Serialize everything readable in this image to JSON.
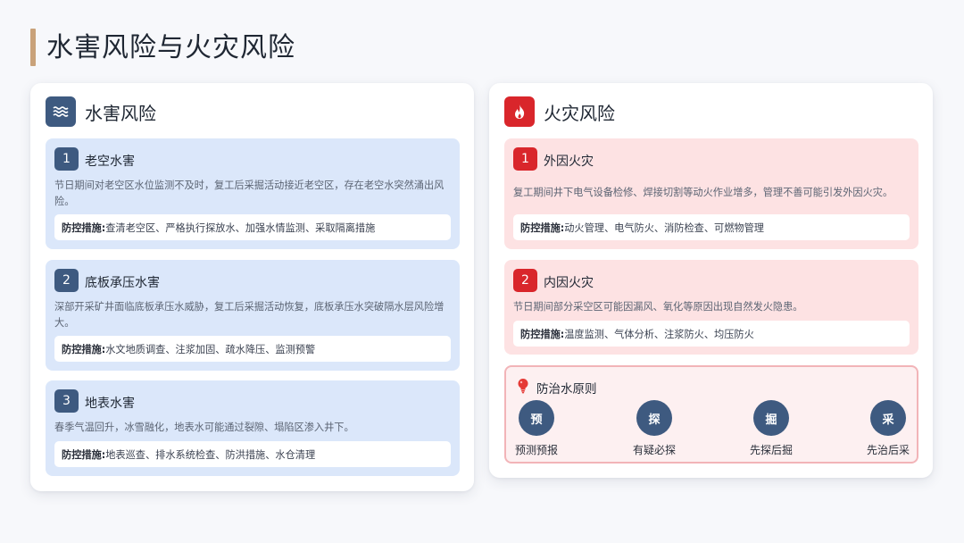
{
  "page": {
    "title": "水害风险与火灾风险"
  },
  "water": {
    "title": "水害风险",
    "icon": "water-waves-icon",
    "accent": "#3e5a80",
    "card_bg": "#dbe7fa",
    "items": [
      {
        "num": "1",
        "title": "老空水害",
        "desc": "节日期间对老空区水位监测不及时，复工后采掘活动接近老空区，存在老空水突然涌出风险。",
        "measure_label": "防控措施:",
        "measure": "查清老空区、严格执行探放水、加强水情监测、采取隔离措施"
      },
      {
        "num": "2",
        "title": "底板承压水害",
        "desc": "深部开采矿井面临底板承压水威胁，复工后采掘活动恢复，底板承压水突破隔水层风险增大。",
        "measure_label": "防控措施:",
        "measure": "水文地质调查、注浆加固、疏水降压、监测预警"
      },
      {
        "num": "3",
        "title": "地表水害",
        "desc": "春季气温回升，冰雪融化，地表水可能通过裂隙、塌陷区渗入井下。",
        "measure_label": "防控措施:",
        "measure": "地表巡查、排水系统检查、防洪措施、水仓清理"
      }
    ]
  },
  "fire": {
    "title": "火灾风险",
    "icon": "flame-icon",
    "accent": "#d9262b",
    "card_bg": "#fde2e3",
    "items": [
      {
        "num": "1",
        "title": "外因火灾",
        "desc": "复工期间井下电气设备检修、焊接切割等动火作业增多，管理不善可能引发外因火灾。",
        "measure_label": "防控措施:",
        "measure": "动火管理、电气防火、消防检查、可燃物管理"
      },
      {
        "num": "2",
        "title": "内因火灾",
        "desc": "节日期间部分采空区可能因漏风、氧化等原因出现自然发火隐患。",
        "measure_label": "防控措施:",
        "measure": "温度监测、气体分析、注浆防火、均压防火"
      }
    ]
  },
  "principle": {
    "title": "防治水原则",
    "icon": "lightbulb-icon",
    "steps": [
      {
        "char": "预",
        "label": "预测预报"
      },
      {
        "char": "探",
        "label": "有疑必探"
      },
      {
        "char": "掘",
        "label": "先探后掘"
      },
      {
        "char": "采",
        "label": "先治后采"
      }
    ]
  }
}
